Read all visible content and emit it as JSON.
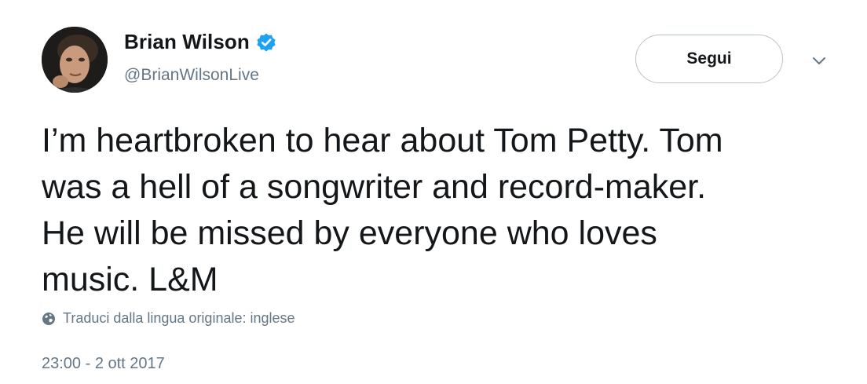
{
  "author": {
    "display_name": "Brian Wilson",
    "handle": "@BrianWilsonLive",
    "avatar_icon": "avatar-photo",
    "verified_icon": "verified-badge-icon",
    "verified_color": "#1da1f2"
  },
  "actions": {
    "follow_label": "Segui",
    "menu_icon": "chevron-down-icon"
  },
  "tweet": {
    "lines": [
      "I’m heartbroken to hear about Tom Petty. Tom",
      "was a hell of a songwriter and record-maker.",
      "He will be missed by everyone who loves",
      "music. L&M"
    ],
    "translate_icon": "globe-icon",
    "translate_label": "Traduci dalla lingua originale: inglese",
    "timestamp": "23:00 - 2 ott 2017"
  },
  "colors": {
    "text": "#14171a",
    "secondary": "#657786",
    "border": "#b8c4cc"
  }
}
